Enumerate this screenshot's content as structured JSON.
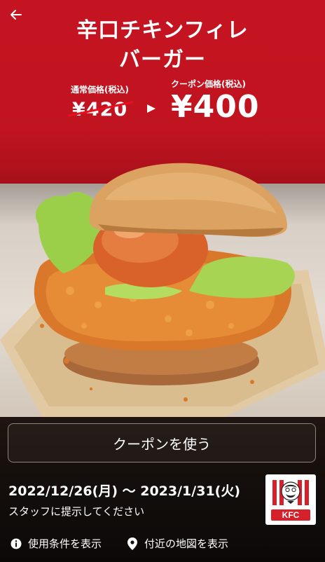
{
  "header": {
    "title_line_1": "辛口チキンフィレ",
    "title_line_2": "バーガー"
  },
  "pricing": {
    "regular_label": "通常価格(税込)",
    "regular_price": "¥420",
    "coupon_label": "クーポン価格(税込)",
    "coupon_price": "¥400"
  },
  "actions": {
    "use_coupon_label": "クーポンを使う"
  },
  "validity": {
    "period": "2022/12/26(月) 〜 2023/1/31(火)",
    "note": "スタッフに提示してください"
  },
  "brand": {
    "logo_text": "KFC",
    "accent_color": "#c51421"
  },
  "footer": {
    "terms_label": "使用条件を表示",
    "map_label": "付近の地図を表示"
  },
  "icons": {
    "back": "arrow-left-icon",
    "arrow": "triangle-right-icon",
    "info": "info-icon",
    "location": "location-pin-icon"
  }
}
